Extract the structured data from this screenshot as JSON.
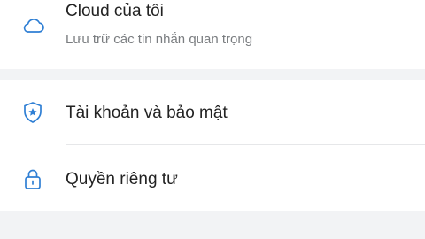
{
  "settings": {
    "cloud": {
      "title": "Cloud của tôi",
      "subtitle": "Lưu trữ các tin nhắn quan trọng",
      "icon": "cloud-icon"
    },
    "account": {
      "title": "Tài khoản và bảo mật",
      "icon": "shield-star-icon"
    },
    "privacy": {
      "title": "Quyền riêng tư",
      "icon": "lock-icon"
    }
  },
  "colors": {
    "icon": "#2f7fd4",
    "section_gap": "#f2f3f5",
    "title": "#222222",
    "subtitle": "#7a7d80"
  }
}
